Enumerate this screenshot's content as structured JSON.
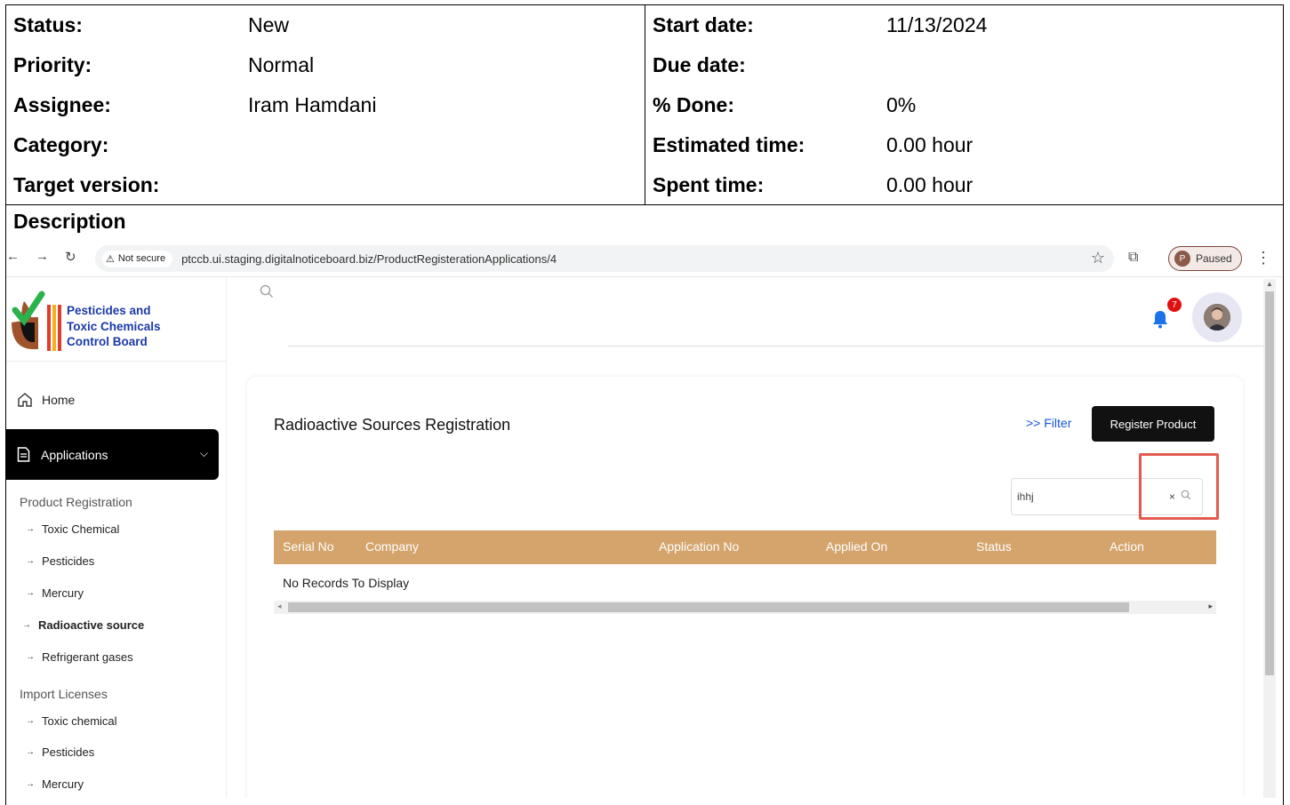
{
  "issue": {
    "left": [
      {
        "label": "Status:",
        "value": "New"
      },
      {
        "label": "Priority:",
        "value": "Normal"
      },
      {
        "label": "Assignee:",
        "value": "Iram Hamdani"
      },
      {
        "label": "Category:",
        "value": ""
      },
      {
        "label": "Target version:",
        "value": ""
      }
    ],
    "right": [
      {
        "label": "Start date:",
        "value": "11/13/2024"
      },
      {
        "label": "Due date:",
        "value": ""
      },
      {
        "label": "% Done:",
        "value": "0%"
      },
      {
        "label": "Estimated time:",
        "value": "0.00 hour"
      },
      {
        "label": "Spent time:",
        "value": "0.00 hour"
      }
    ],
    "description_title": "Description"
  },
  "browser": {
    "not_secure": "Not secure",
    "url": "ptccb.ui.staging.digitalnoticeboard.biz/ProductRegisterationApplications/4",
    "profile_initial": "P",
    "profile_status": "Paused"
  },
  "sidebar": {
    "logo_lines": [
      "Pesticides and",
      "Toxic Chemicals",
      "Control Board"
    ],
    "home": "Home",
    "applications": "Applications",
    "product_registration": "Product Registration",
    "product_items": [
      "Toxic Chemical",
      "Pesticides",
      "Mercury",
      "Radioactive source",
      "Refrigerant gases"
    ],
    "import_licenses": "Import Licenses",
    "import_items": [
      "Toxic chemical",
      "Pesticides",
      "Mercury"
    ]
  },
  "header": {
    "notification_count": "7"
  },
  "main": {
    "title": "Radioactive Sources Registration",
    "filter": ">> Filter",
    "register_button": "Register Product",
    "search_value": "ihhj",
    "clear_symbol": "×",
    "columns": [
      "Serial No",
      "Company",
      "Application No",
      "Applied On",
      "Status",
      "Action"
    ],
    "empty_message": "No Records To Display"
  },
  "colors": {
    "table_header": "#d4a46c",
    "highlight_box": "#e35a50",
    "link": "#1a56d6",
    "logo_text": "#1b3aa8"
  }
}
